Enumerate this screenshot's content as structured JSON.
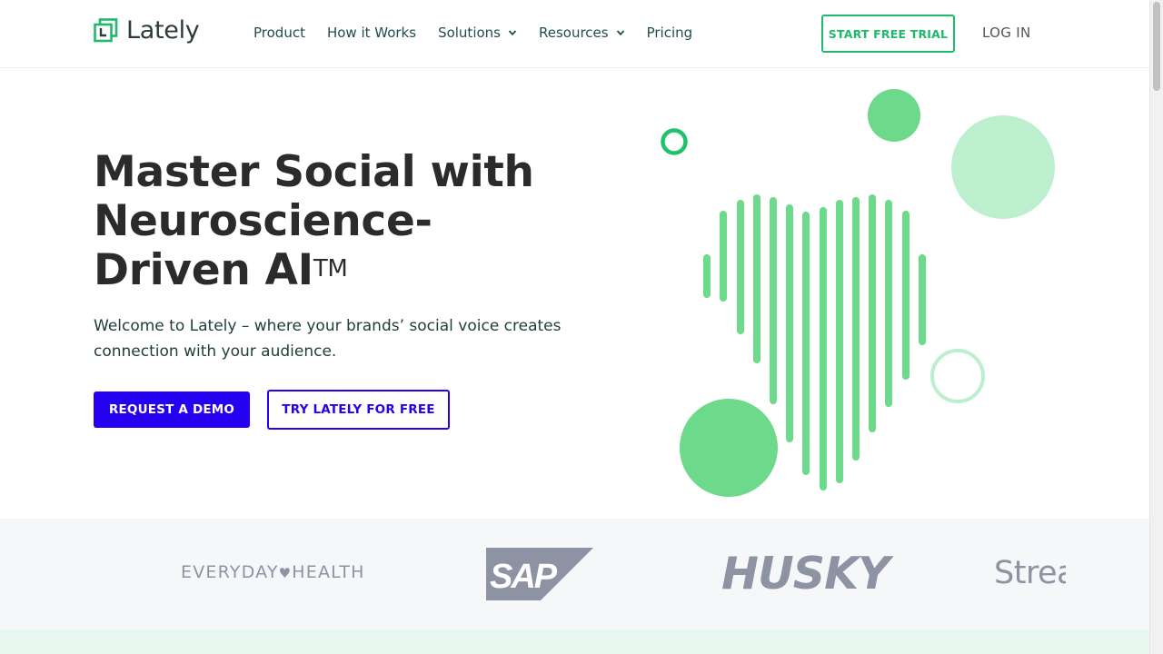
{
  "header": {
    "logo_text": "Lately",
    "nav": [
      {
        "label": "Product",
        "has_dropdown": false
      },
      {
        "label": "How it Works",
        "has_dropdown": false
      },
      {
        "label": "Solutions",
        "has_dropdown": true
      },
      {
        "label": "Resources",
        "has_dropdown": true
      },
      {
        "label": "Pricing",
        "has_dropdown": false
      }
    ],
    "trial_button": "START FREE TRIAL",
    "login": "LOG IN"
  },
  "hero": {
    "title_line1": "Master Social with",
    "title_line2": "Neuroscience-",
    "title_line3": "Driven AI",
    "title_mark": "TM",
    "subtitle": "Welcome to Lately – where your brands’ social voice creates connection with your audience.",
    "demo_button": "REQUEST A DEMO",
    "free_button": "TRY LATELY FOR FREE"
  },
  "logos": {
    "everyday_a": "EVERYDAY",
    "everyday_b": "HEALTH",
    "sap": "SAP",
    "husky": "HUSKY",
    "strea": "Strea"
  },
  "colors": {
    "brand_green": "#1fb96a",
    "art_green": "#6dd98a",
    "art_light_green": "#bcefcd",
    "cta_blue": "#2600f0",
    "logo_gray": "#8d93a2"
  },
  "icons": [
    "lately-logo-icon",
    "chevron-down-icon",
    "apple-icon"
  ]
}
